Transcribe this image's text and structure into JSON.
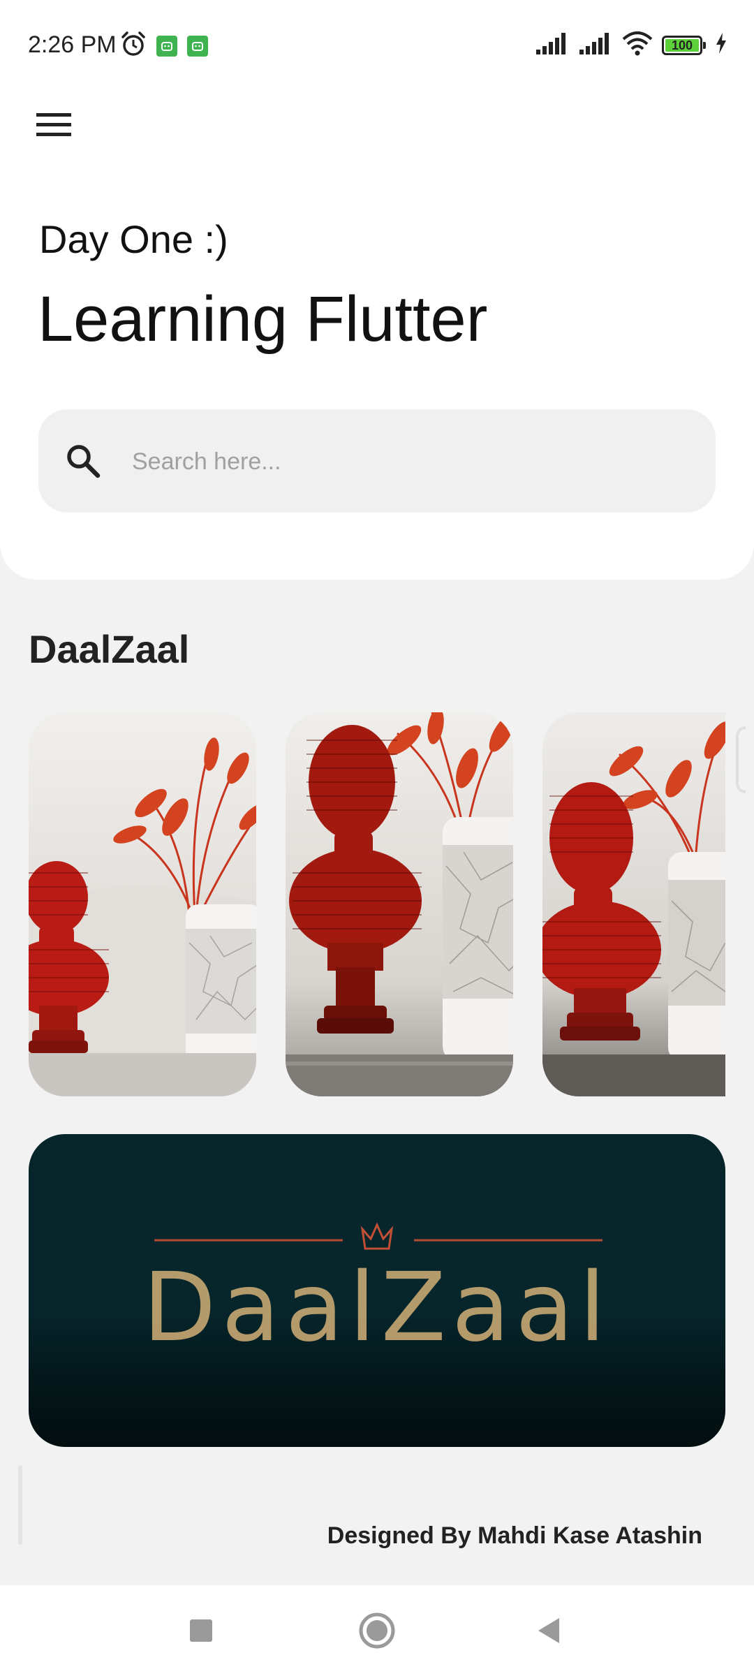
{
  "status_bar": {
    "time": "2:26 PM",
    "battery": "100",
    "battery_level": 1.0,
    "icons": [
      "alarm-icon",
      "android-notification-icon",
      "android-notification-icon",
      "signal-icon",
      "signal-icon",
      "wifi-icon",
      "battery-icon",
      "charging-icon"
    ]
  },
  "header": {
    "menu_icon": "hamburger-menu-icon",
    "subtitle": "Day One :)",
    "title": "Learning Flutter"
  },
  "search": {
    "icon": "search-icon",
    "placeholder": "Search here..."
  },
  "section": {
    "title": "DaalZaal",
    "cards": [
      {
        "name": "sculpture-photo-1"
      },
      {
        "name": "sculpture-photo-2"
      },
      {
        "name": "sculpture-photo-3"
      }
    ]
  },
  "banner": {
    "logo_text": "DaalZaal",
    "crown_icon": "crown-icon"
  },
  "footer": {
    "credit": "Designed By Mahdi Kase Atashin"
  },
  "nav": {
    "buttons": [
      "recents-square-icon",
      "home-circle-icon",
      "back-triangle-icon"
    ]
  },
  "colors": {
    "background": "#f2f2f2",
    "header": "#ffffff",
    "banner": "#06252b",
    "logo": "#c7a873",
    "sculpture": "#b81c14",
    "battery": "#5cd13a"
  }
}
